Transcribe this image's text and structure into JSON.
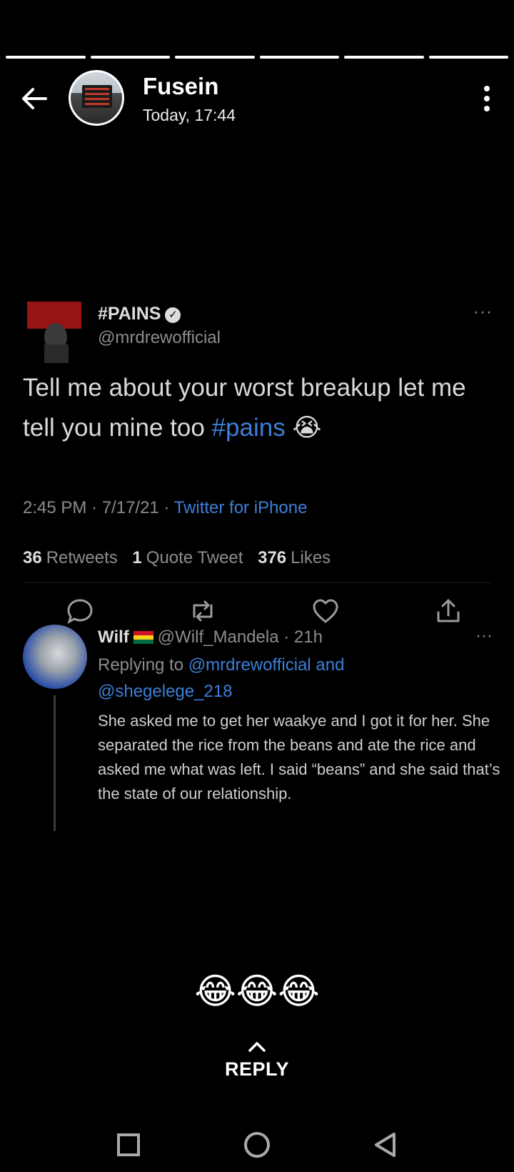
{
  "story": {
    "segments": 6,
    "author_name": "Fusein",
    "timestamp": "Today, 17:44"
  },
  "tweet": {
    "display_name": "#PAINS",
    "handle": "@mrdrewofficial",
    "text_main": "Tell me about your worst breakup let me tell you mine too ",
    "hashtag": "#pains",
    "emoji": "😭",
    "meta_time": "2:45 PM · 7/17/21 · ",
    "meta_source": "Twitter for iPhone",
    "retweets_count": "36",
    "retweets_label": "Retweets",
    "quote_count": "1",
    "quote_label": "Quote Tweet",
    "likes_count": "376",
    "likes_label": "Likes"
  },
  "reply": {
    "display_name": "Wilf",
    "handle_time": "@Wilf_Mandela · 21h",
    "replying_prefix": "Replying to ",
    "replying_mentions": "@mrdrewofficial and @shegelege_218",
    "text": "She asked me to get her waakye and I got it for her. She separated the rice from the beans and ate the rice and asked me what was left. I said “beans” and she said that’s the state of our relationship."
  },
  "caption": "😂😂😂",
  "reply_button": {
    "label": "REPLY"
  },
  "icons": {
    "back": "arrow-left-icon",
    "menu": "more-vertical-icon",
    "comment": "comment-icon",
    "retweet": "retweet-icon",
    "like": "heart-icon",
    "share": "share-icon",
    "nav_recent": "square-icon",
    "nav_home": "circle-icon",
    "nav_back": "triangle-back-icon"
  }
}
